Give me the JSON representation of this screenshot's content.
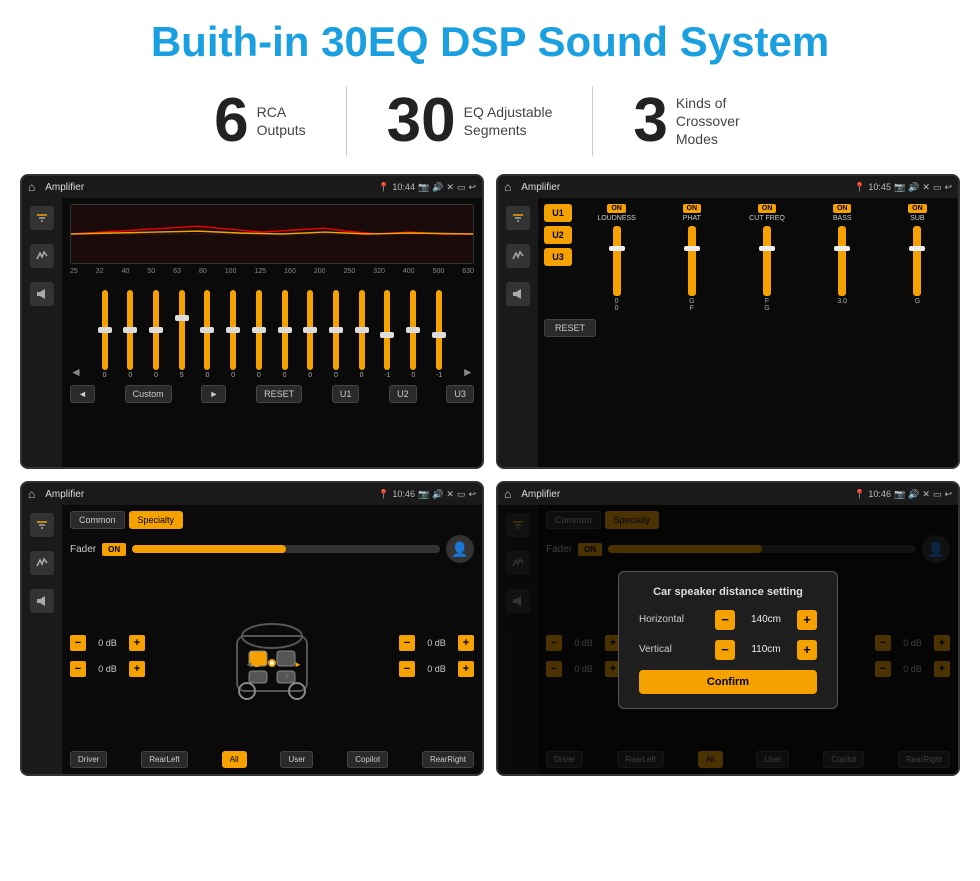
{
  "header": {
    "title": "Buith-in 30EQ DSP Sound System"
  },
  "stats": [
    {
      "number": "6",
      "line1": "RCA",
      "line2": "Outputs"
    },
    {
      "number": "30",
      "line1": "EQ Adjustable",
      "line2": "Segments"
    },
    {
      "number": "3",
      "line1": "Kinds of",
      "line2": "Crossover Modes"
    }
  ],
  "screens": {
    "eq": {
      "status_bar": {
        "title": "Amplifier",
        "time": "10:44"
      },
      "eq_labels": [
        "25",
        "32",
        "40",
        "50",
        "63",
        "80",
        "100",
        "125",
        "160",
        "200",
        "250",
        "320",
        "400",
        "500",
        "630"
      ],
      "slider_values": [
        "0",
        "0",
        "0",
        "5",
        "0",
        "0",
        "0",
        "0",
        "0",
        "0",
        "0",
        "-1",
        "0",
        "-1"
      ],
      "buttons": [
        "◄",
        "Custom",
        "►",
        "RESET",
        "U1",
        "U2",
        "U3"
      ]
    },
    "crossover": {
      "status_bar": {
        "title": "Amplifier",
        "time": "10:45"
      },
      "u_buttons": [
        "U1",
        "U2",
        "U3"
      ],
      "channels": [
        {
          "on": "ON",
          "label": "LOUDNESS"
        },
        {
          "on": "ON",
          "label": "PHAT"
        },
        {
          "on": "ON",
          "label": "CUT FREQ"
        },
        {
          "on": "ON",
          "label": "BASS"
        },
        {
          "on": "ON",
          "label": "SUB"
        }
      ],
      "reset_label": "RESET"
    },
    "fader": {
      "status_bar": {
        "title": "Amplifier",
        "time": "10:46"
      },
      "tabs": [
        "Common",
        "Specialty"
      ],
      "fader_label": "Fader",
      "on_label": "ON",
      "speaker_values": [
        "0 dB",
        "0 dB",
        "0 dB",
        "0 dB"
      ],
      "buttons": [
        "Driver",
        "RearLeft",
        "All",
        "User",
        "Copilot",
        "RearRight"
      ]
    },
    "distance": {
      "status_bar": {
        "title": "Amplifier",
        "time": "10:46"
      },
      "tabs": [
        "Common",
        "Specialty"
      ],
      "fader_label": "Fader",
      "on_label": "ON",
      "modal": {
        "title": "Car speaker distance setting",
        "horizontal_label": "Horizontal",
        "horizontal_value": "140cm",
        "vertical_label": "Vertical",
        "vertical_value": "110cm",
        "confirm_label": "Confirm"
      }
    }
  }
}
